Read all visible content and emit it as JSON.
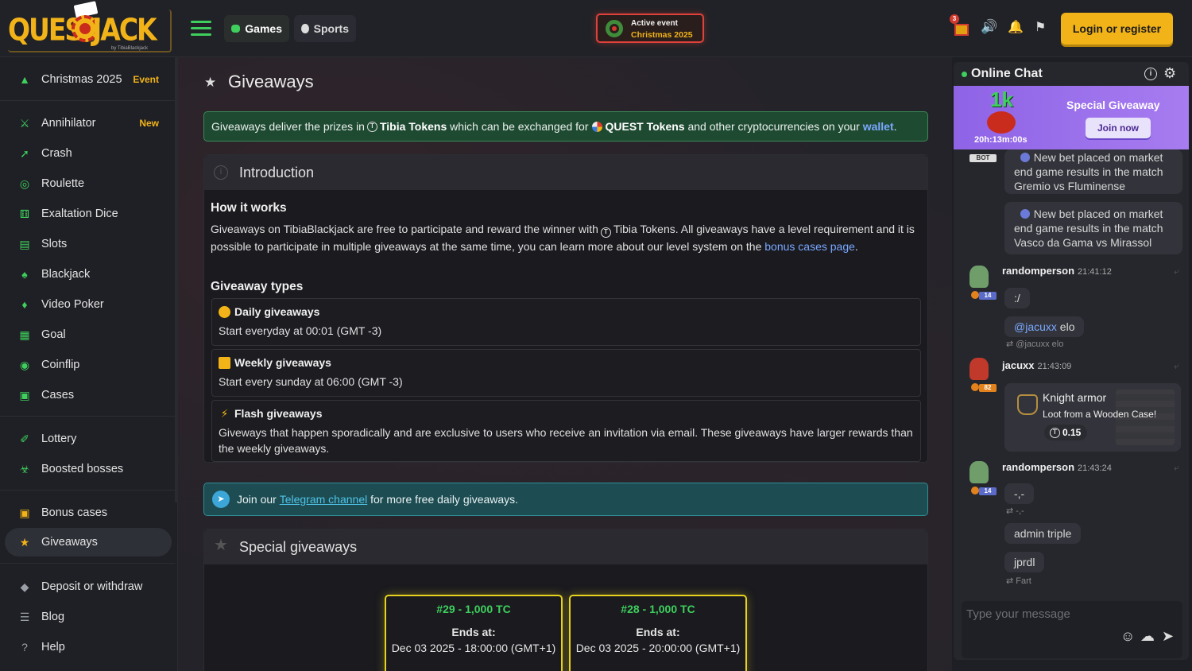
{
  "header": {
    "logo": {
      "left": "QUEST",
      "right": "JACK",
      "by": "by TibiaBlackjack"
    },
    "nav": [
      {
        "label": "Games"
      },
      {
        "label": "Sports"
      }
    ],
    "event": {
      "line1": "Active event",
      "line2": "Christmas 2025"
    },
    "gift_badge": "3",
    "login_label": "Login or register"
  },
  "sidebar": {
    "event": {
      "label": "Christmas 2025",
      "tag": "Event"
    },
    "games": [
      {
        "label": "Annihilator",
        "tag": "New"
      },
      {
        "label": "Crash"
      },
      {
        "label": "Roulette"
      },
      {
        "label": "Exaltation Dice"
      },
      {
        "label": "Slots"
      },
      {
        "label": "Blackjack"
      },
      {
        "label": "Video Poker"
      },
      {
        "label": "Goal"
      },
      {
        "label": "Coinflip"
      },
      {
        "label": "Cases"
      }
    ],
    "extras": [
      {
        "label": "Lottery"
      },
      {
        "label": "Boosted bosses"
      }
    ],
    "rewards": [
      {
        "label": "Bonus cases"
      },
      {
        "label": "Giveaways"
      }
    ],
    "other": [
      {
        "label": "Deposit or withdraw"
      },
      {
        "label": "Blog"
      },
      {
        "label": "Help"
      }
    ]
  },
  "main": {
    "title": "Giveaways",
    "info": {
      "pre": "Giveaways deliver the prizes in",
      "tibia_tokens": "Tibia Tokens",
      "mid": "which can be exchanged for",
      "quest_tokens": "QUEST Tokens",
      "post": "and other cryptocurrencies on your",
      "wallet": "wallet",
      "end": "."
    },
    "intro": {
      "title": "Introduction",
      "how_title": "How it works",
      "p1": "Giveaways on TibiaBlackjack are free to participate and reward the winner with",
      "p2": "Tibia Tokens. All giveaways have a level requirement and it is possible to participate in multiple giveaways at the same time, you can learn more about our level system on the",
      "link": "bonus cases page",
      "p3": ".",
      "types_title": "Giveaway types",
      "types": [
        {
          "title": "Daily giveaways",
          "desc": "Start everyday at 00:01 (GMT -3)"
        },
        {
          "title": "Weekly giveaways",
          "desc": "Start every sunday at 06:00 (GMT -3)"
        },
        {
          "title": "Flash giveaways",
          "desc": "Giveways that happen sporadically and are exclusive to users who receive an invitation via email. These giveaways have larger rewards than the weekly giveaways."
        }
      ]
    },
    "telegram": {
      "pre": "Join our",
      "link": "Telegram channel",
      "post": "for more free daily giveaways."
    },
    "special": {
      "title": "Special giveaways",
      "cards": [
        {
          "num": "#29 - 1,000 TC",
          "ends": "Ends at:",
          "date": "Dec 03 2025 - 18:00:00 (GMT+1)"
        },
        {
          "num": "#28 - 1,000 TC",
          "ends": "Ends at:",
          "date": "Dec 03 2025 - 20:00:00 (GMT+1)"
        }
      ]
    }
  },
  "chat": {
    "title": "Online Chat",
    "promo": {
      "amount": "1k",
      "timer": "20h:13m:00s",
      "title": "Special Giveaway",
      "join": "Join now"
    },
    "bot_tag": "BOT",
    "bot_msgs": [
      "New bet placed on market end game results in the match Gremio vs Fluminense",
      "New bet placed on market end game results in the match Vasco da Gama vs Mirassol"
    ],
    "msgs": [
      {
        "user": "randomperson",
        "time": "21:41:12",
        "level": "14",
        "lines": [
          ":/"
        ],
        "mention": "@jacuxx",
        "mention_rest": " elo",
        "translated": "@jacuxx elo"
      },
      {
        "user": "jacuxx",
        "time": "21:43:09",
        "level": "82",
        "item": {
          "name": "Knight armor",
          "source": "Loot from a Wooden Case!",
          "value": "0.15"
        }
      },
      {
        "user": "randomperson",
        "time": "21:43:24",
        "level": "14",
        "line1": "-,-",
        "trans1": "-,-",
        "line2": "admin triple",
        "line3": "jprdl",
        "trans3": "Fart"
      }
    ],
    "input_placeholder": "Type your message"
  }
}
